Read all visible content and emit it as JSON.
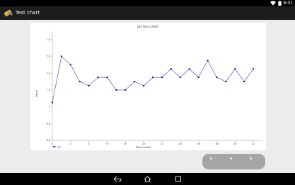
{
  "status_bar": {
    "time": "8:01",
    "icons": [
      "wifi-icon",
      "battery-icon"
    ]
  },
  "action_bar": {
    "title": "Test chart",
    "icon": "app-icon"
  },
  "chart_data": {
    "type": "line",
    "title": "pH test chart",
    "xlabel": "Test number",
    "ylabel": "Value",
    "x": [
      0,
      1,
      2,
      3,
      4,
      5,
      6,
      7,
      8,
      9,
      10,
      11,
      12,
      13,
      14,
      15,
      16,
      17,
      18,
      19,
      20,
      21,
      22
    ],
    "series": [
      {
        "name": "pH",
        "values": [
          7.05,
          7.6,
          7.5,
          7.3,
          7.25,
          7.35,
          7.35,
          7.2,
          7.2,
          7.3,
          7.25,
          7.35,
          7.35,
          7.45,
          7.35,
          7.45,
          7.35,
          7.55,
          7.35,
          7.3,
          7.45,
          7.3,
          7.45
        ]
      }
    ],
    "x_ticks": [
      "0",
      "2",
      "4",
      "6",
      "8",
      "10",
      "12",
      "14",
      "16",
      "18",
      "20",
      "22"
    ],
    "y_ticks": [
      "7.8",
      "7.6",
      "7.4",
      "7.2",
      "7",
      "6.8",
      "6.6"
    ],
    "xlim": [
      0,
      23
    ],
    "ylim": [
      6.6,
      7.9
    ],
    "line_color": "#3b3bde",
    "legend_position": "bottom-left",
    "grid": false
  },
  "navigation_bar": {
    "buttons": [
      "back-icon",
      "home-icon",
      "recents-icon"
    ]
  },
  "overlay_controls": {
    "dots": 3
  }
}
